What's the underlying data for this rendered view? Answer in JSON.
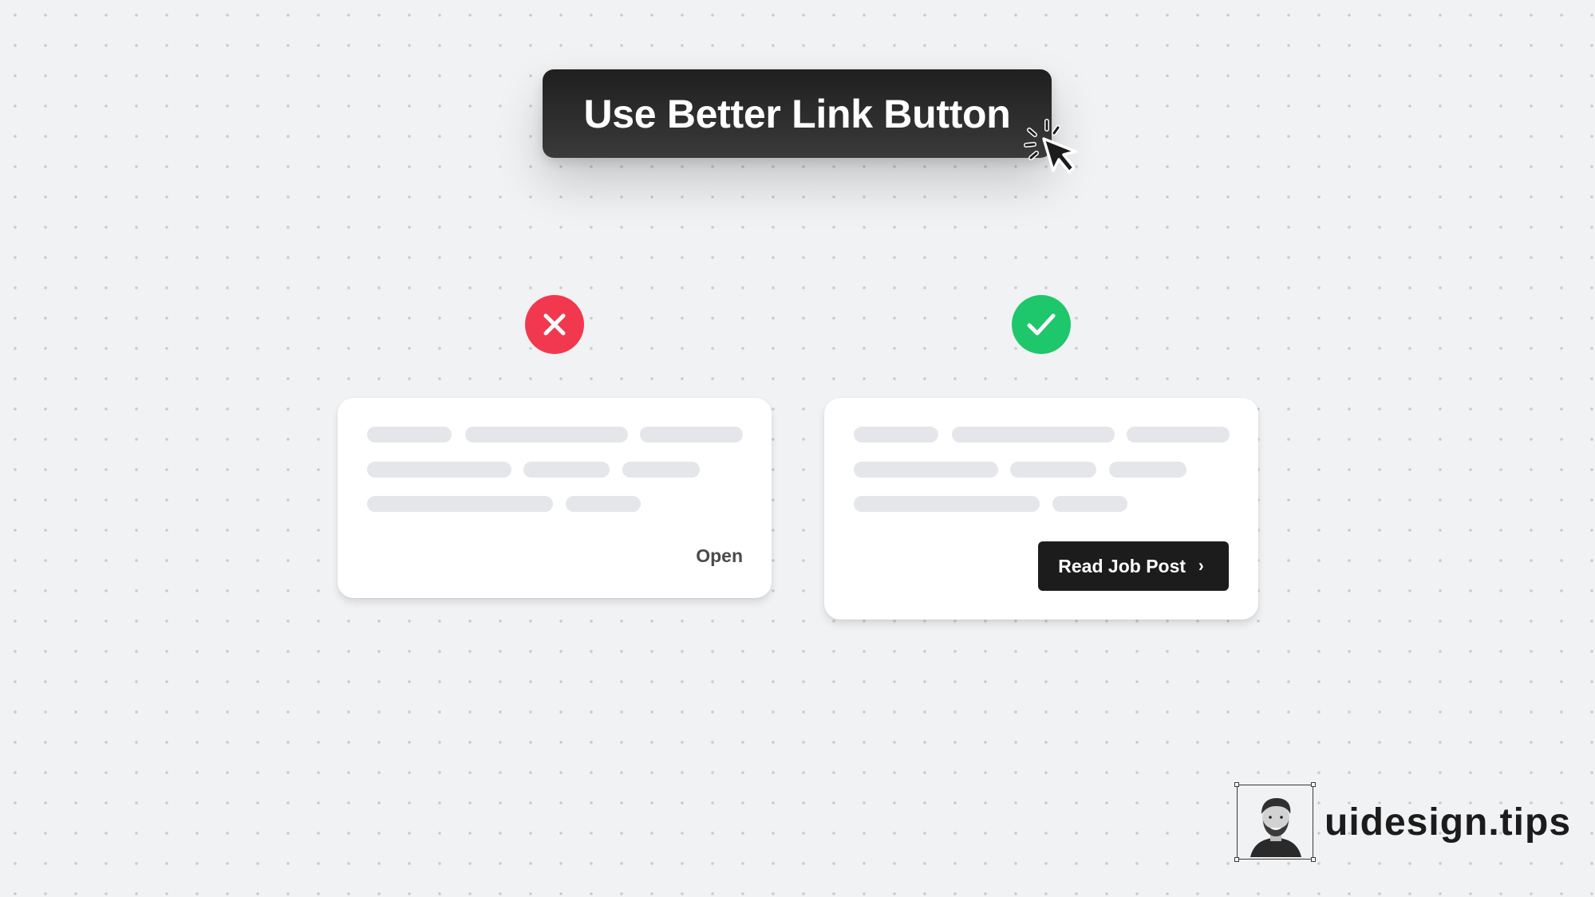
{
  "title": {
    "text": "Use Better Link Button"
  },
  "icons": {
    "cursor": "cursor-click-icon",
    "bad": "x-icon",
    "good": "check-icon",
    "chevron": "chevron-right-icon"
  },
  "colors": {
    "background": "#f1f2f4",
    "bad": "#f2384f",
    "good": "#1ec76b",
    "button": "#1c1c1c",
    "placeholder": "#e5e6e9"
  },
  "bad_example": {
    "link_label": "Open"
  },
  "good_example": {
    "button_label": "Read Job Post",
    "button_chevron": "›"
  },
  "brand": {
    "name": "uidesign.tips"
  }
}
